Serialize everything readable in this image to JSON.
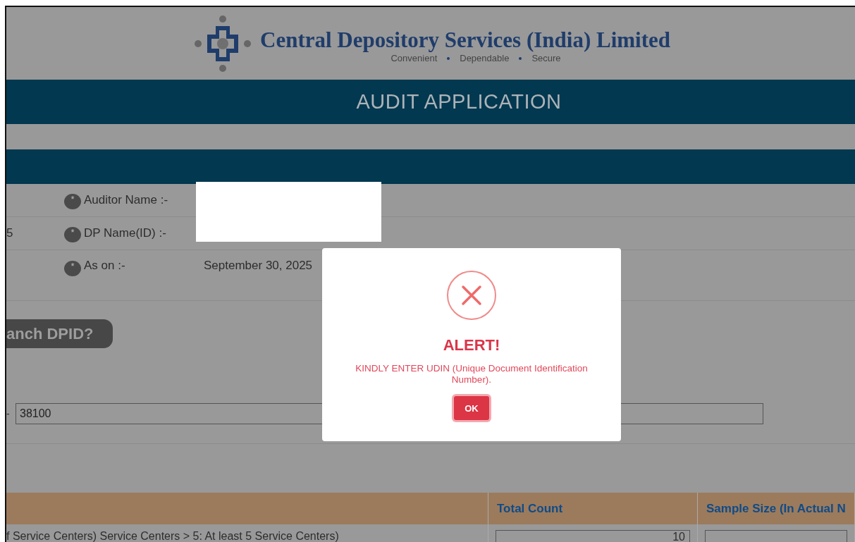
{
  "header": {
    "logo_text": "Central Depository Services (India) Limited",
    "tagline": [
      "Convenient",
      "Dependable",
      "Secure"
    ],
    "title": "AUDIT APPLICATION"
  },
  "form_rows": [
    {
      "left_fragment": "",
      "marker": "*",
      "label": "Auditor Name :-",
      "value": ""
    },
    {
      "left_fragment": "5",
      "marker": "*",
      "label": "DP Name(ID) :-",
      "value": ""
    },
    {
      "left_fragment": "",
      "marker": "*",
      "label": "As on :-",
      "value": "September 30, 2025"
    }
  ],
  "branch_button": {
    "label": "anch DPID?"
  },
  "dpid_field": {
    "label_fragment": "-",
    "value": "38100"
  },
  "table": {
    "columns": [
      "",
      "Total Count",
      "Sample Size (In Actual N"
    ],
    "rows": [
      {
        "cells": [
          "f Service Centers) Service Centers > 5: At least 5 Service Centers)",
          "10",
          ""
        ]
      }
    ]
  },
  "dialog": {
    "title": "ALERT!",
    "message": "KINDLY ENTER UDIN (Unique Document Identification Number).",
    "button": "OK"
  }
}
